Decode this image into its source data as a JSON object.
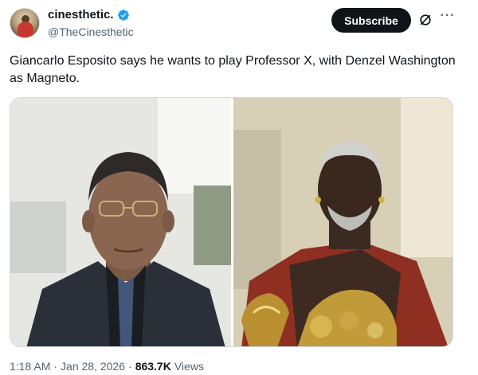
{
  "author": {
    "display_name": "cinesthetic.",
    "handle": "@TheCinesthetic",
    "verified_icon": "verified-badge-icon",
    "accent": "#1d9bf0"
  },
  "actions": {
    "subscribe_label": "Subscribe",
    "grok_icon": "grok-icon",
    "more_icon": "more-icon",
    "more_glyph": "···"
  },
  "tweet": {
    "text": "Giancarlo Esposito says he wants to play Professor X, with Denzel Washington as Magneto."
  },
  "media": {
    "left_image": "photo of Giancarlo Esposito in dark suit with glasses",
    "right_image": "photo of Denzel Washington in ornate gold and red costume"
  },
  "meta": {
    "time": "1:18 AM",
    "sep1": "·",
    "date": "Jan 28, 2026",
    "sep2": "·",
    "views_count": "863.7K",
    "views_label": "Views"
  }
}
